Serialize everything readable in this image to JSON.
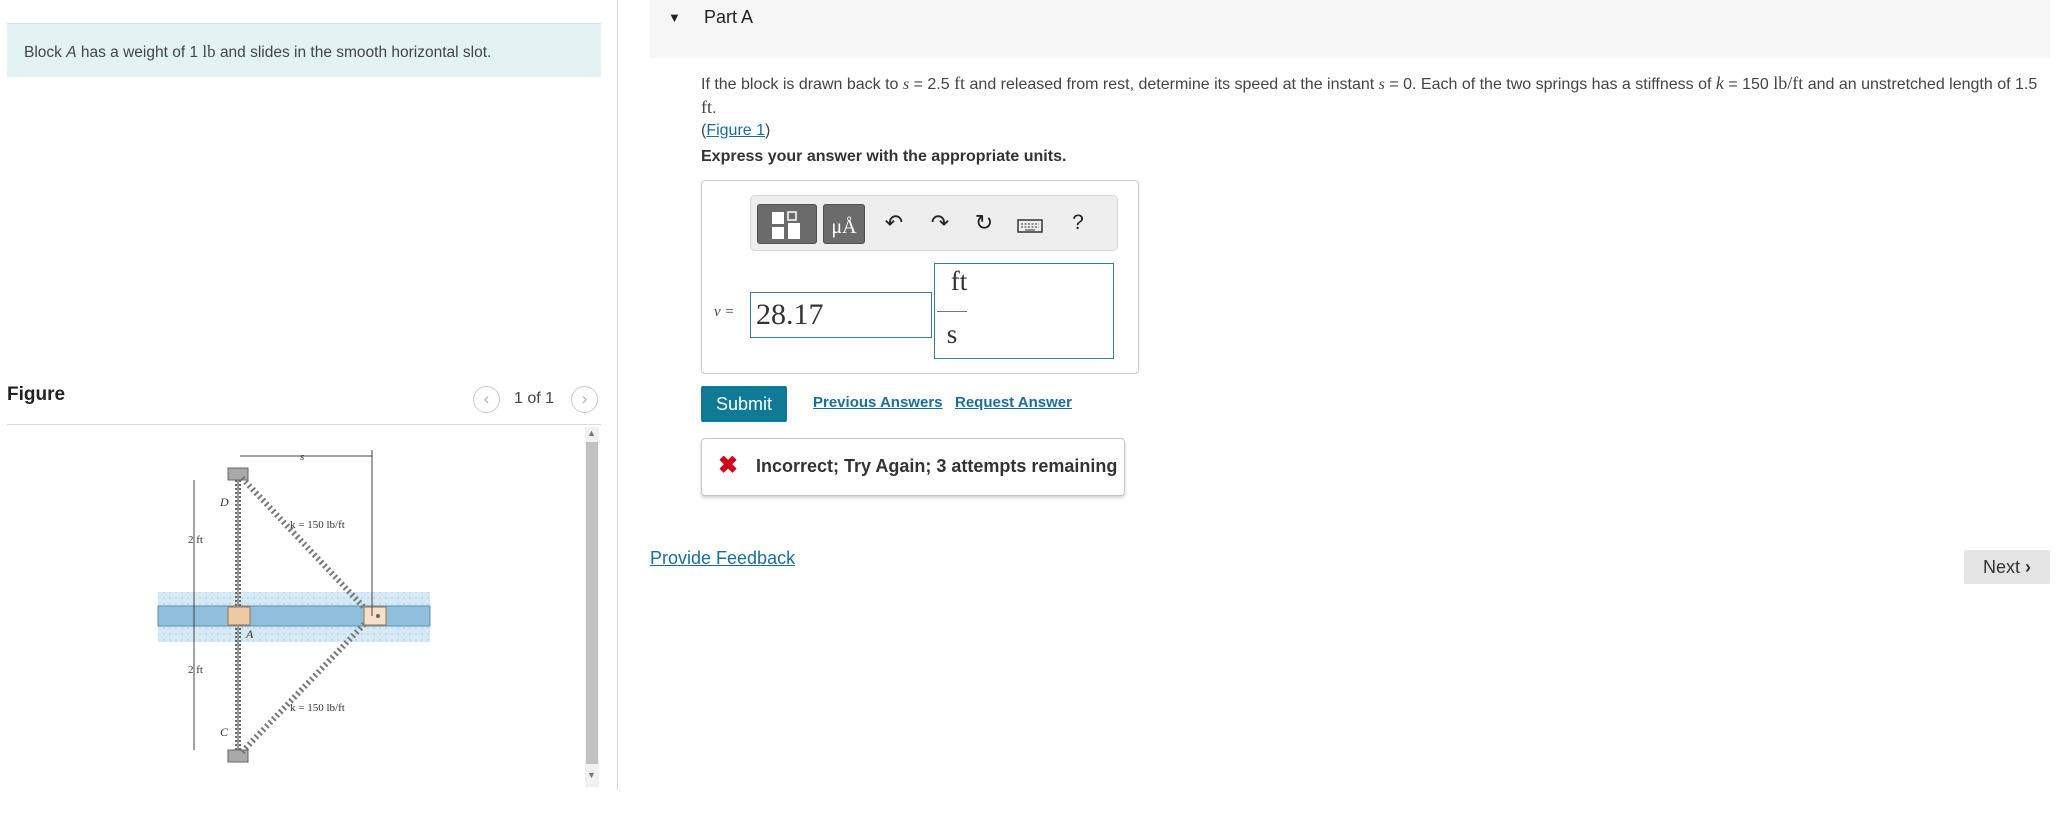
{
  "problem": {
    "text_before": "Block",
    "block_symbol": "A",
    "text_middle": "has a weight of 1",
    "weight_unit": "lb",
    "text_after": "and slides in the smooth horizontal slot."
  },
  "figure_panel": {
    "heading": "Figure",
    "counter": "1 of 1",
    "prev_icon": "chevron-left-icon",
    "next_icon": "chevron-right-icon",
    "diagram": {
      "s_label": "s",
      "d_label": "D",
      "a_label": "A",
      "c_label": "C",
      "upper_spring_label": "k = 150 lb/ft",
      "lower_spring_label": "k = 150 lb/ft",
      "upper_dim": "2 ft",
      "lower_dim": "2 ft"
    }
  },
  "part": {
    "caret_icon": "caret-down-icon",
    "title": "Part A",
    "question": {
      "t1": "If the block is drawn back to",
      "s1": "s",
      "t2": "= 2.5",
      "u1": "ft",
      "t3": "and released from rest, determine its speed at the instant",
      "s2": "s",
      "t4": "= 0. Each of the two springs has a stiffness of",
      "k": "k",
      "t5": "= 150",
      "u2": "lb/ft",
      "t6": "and an unstretched length of 1.5",
      "u3": "ft",
      "t7": ".",
      "figure_link_open": "(",
      "figure_link": "Figure 1",
      "figure_link_close": ")"
    },
    "instruction": "Express your answer with the appropriate units."
  },
  "toolbar": {
    "templates_icon": "templates-icon",
    "units_label": "μÅ",
    "undo_icon": "undo-icon",
    "redo_icon": "redo-icon",
    "reset_icon": "reset-icon",
    "keyboard_icon": "keyboard-icon",
    "help_label": "?"
  },
  "answer": {
    "variable_label": "v =",
    "value": "28.17",
    "unit_numerator": "ft",
    "unit_denominator": "s"
  },
  "actions": {
    "submit": "Submit",
    "previous_answers": "Previous Answers",
    "request_answer": "Request Answer"
  },
  "feedback": {
    "icon": "x-icon",
    "message": "Incorrect; Try Again; 3 attempts remaining"
  },
  "footer": {
    "provide_feedback": "Provide Feedback",
    "next_label": "Next",
    "next_icon": "chevron-right-icon"
  },
  "colors": {
    "accent": "#0e7a96",
    "link": "#1a6e9a",
    "error": "#d0021b",
    "problem_bg": "#e3f3f4"
  }
}
